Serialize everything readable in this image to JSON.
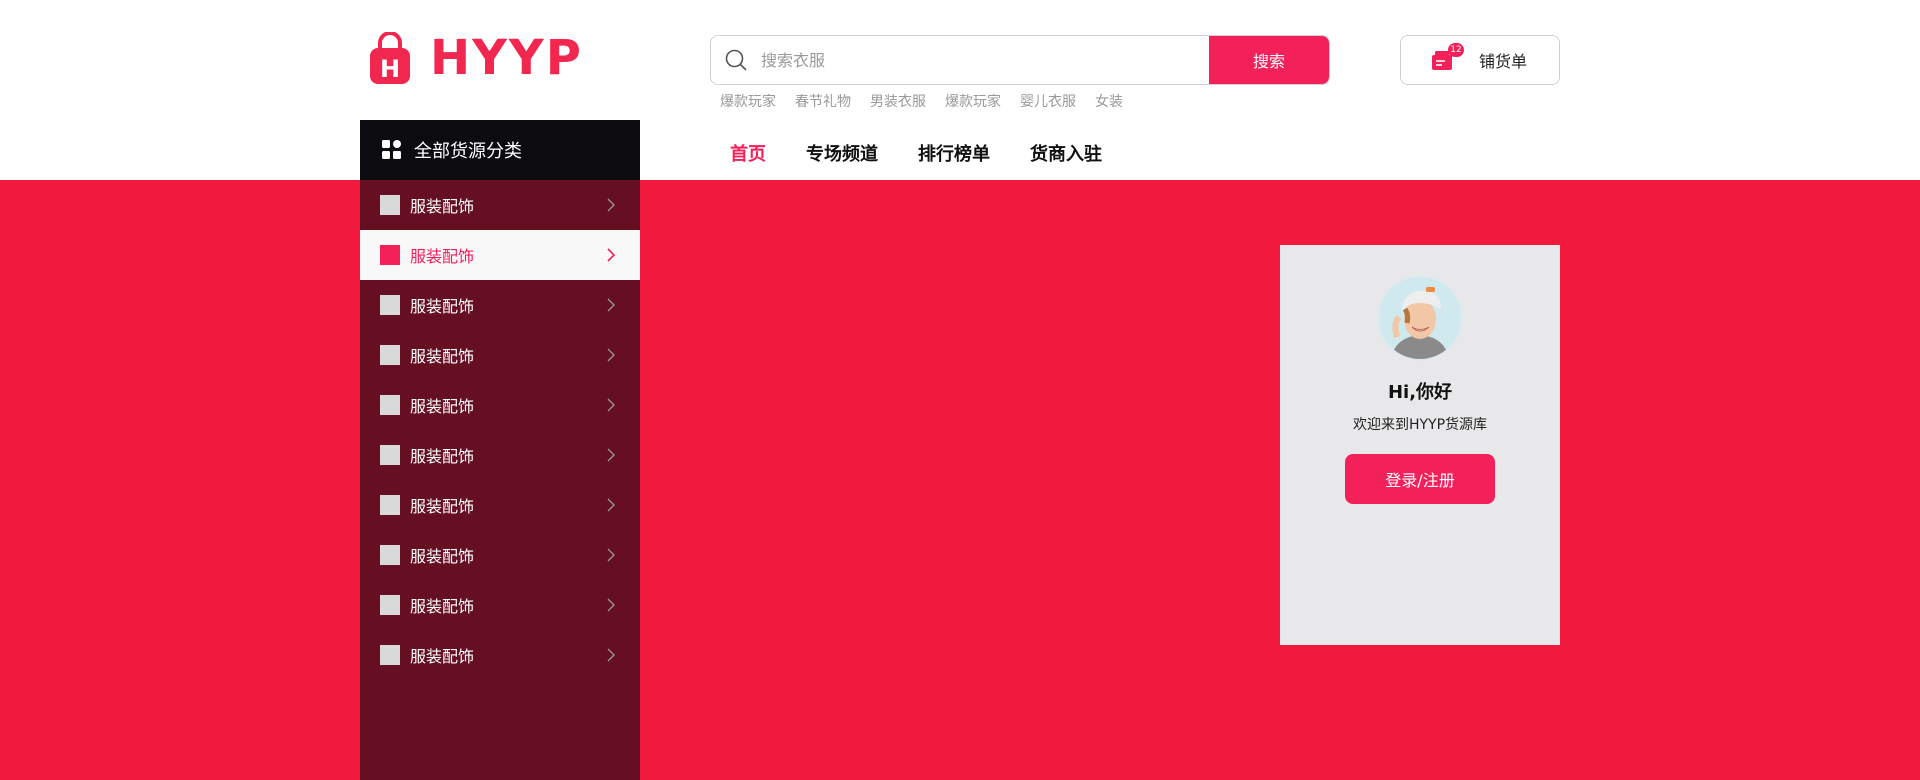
{
  "brand": {
    "name": "HYYP",
    "logo_letter": "H",
    "color": "#f2274f"
  },
  "search": {
    "placeholder": "搜索衣服",
    "button_label": "搜索"
  },
  "hot_keywords": [
    "爆款玩家",
    "春节礼物",
    "男装衣服",
    "爆款玩家",
    "婴儿衣服",
    "女装"
  ],
  "cart": {
    "label": "铺货单",
    "badge": "12"
  },
  "category_header": {
    "label": "全部货源分类"
  },
  "nav": [
    {
      "label": "首页",
      "active": true
    },
    {
      "label": "专场频道",
      "active": false
    },
    {
      "label": "排行榜单",
      "active": false
    },
    {
      "label": "货商入驻",
      "active": false
    }
  ],
  "categories": [
    {
      "label": "服装配饰",
      "active": false
    },
    {
      "label": "服装配饰",
      "active": true
    },
    {
      "label": "服装配饰",
      "active": false
    },
    {
      "label": "服装配饰",
      "active": false
    },
    {
      "label": "服装配饰",
      "active": false
    },
    {
      "label": "服装配饰",
      "active": false
    },
    {
      "label": "服装配饰",
      "active": false
    },
    {
      "label": "服装配饰",
      "active": false
    },
    {
      "label": "服装配饰",
      "active": false
    },
    {
      "label": "服装配饰",
      "active": false
    }
  ],
  "login_card": {
    "greeting": "Hi,你好",
    "welcome": "欢迎来到HYYP货源库",
    "button_label": "登录/注册"
  },
  "colors": {
    "accent": "#f4205a",
    "banner": "#f2193e",
    "sidebar": "#660f23",
    "dark": "#0b0b10"
  }
}
